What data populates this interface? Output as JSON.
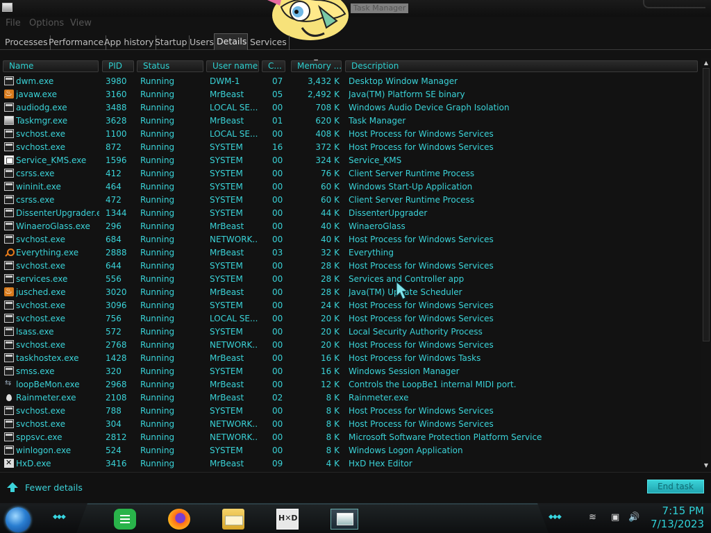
{
  "window": {
    "title": "Task Manager"
  },
  "menu": [
    "File",
    "Options",
    "View"
  ],
  "tabs": [
    {
      "label": "Processes",
      "active": false
    },
    {
      "label": "Performance",
      "active": false
    },
    {
      "label": "App history",
      "active": false
    },
    {
      "label": "Startup",
      "active": false
    },
    {
      "label": "Users",
      "active": false
    },
    {
      "label": "Details",
      "active": true
    },
    {
      "label": "Services",
      "active": false
    }
  ],
  "columns": [
    "Name",
    "PID",
    "Status",
    "User name",
    "C...",
    "Memory ...",
    "Description"
  ],
  "rows": [
    {
      "icon": "exe-icon",
      "name": "dwm.exe",
      "pid": "3980",
      "status": "Running",
      "user": "DWM-1",
      "cpu": "07",
      "mem": "3,432 K",
      "desc": "Desktop Window Manager"
    },
    {
      "icon": "java-icon",
      "name": "javaw.exe",
      "pid": "3160",
      "status": "Running",
      "user": "MrBeast",
      "cpu": "05",
      "mem": "2,492 K",
      "desc": "Java(TM) Platform SE binary"
    },
    {
      "icon": "exe-icon",
      "name": "audiodg.exe",
      "pid": "3488",
      "status": "Running",
      "user": "LOCAL SE...",
      "cpu": "00",
      "mem": "708 K",
      "desc": "Windows Audio Device Graph Isolation"
    },
    {
      "icon": "task-manager-icon",
      "name": "Taskmgr.exe",
      "pid": "3628",
      "status": "Running",
      "user": "MrBeast",
      "cpu": "01",
      "mem": "620 K",
      "desc": "Task Manager"
    },
    {
      "icon": "exe-icon",
      "name": "svchost.exe",
      "pid": "1100",
      "status": "Running",
      "user": "LOCAL SE...",
      "cpu": "00",
      "mem": "408 K",
      "desc": "Host Process for Windows Services"
    },
    {
      "icon": "exe-icon",
      "name": "svchost.exe",
      "pid": "872",
      "status": "Running",
      "user": "SYSTEM",
      "cpu": "16",
      "mem": "372 K",
      "desc": "Host Process for Windows Services"
    },
    {
      "icon": "service-icon",
      "name": "Service_KMS.exe",
      "pid": "1596",
      "status": "Running",
      "user": "SYSTEM",
      "cpu": "00",
      "mem": "324 K",
      "desc": "Service_KMS"
    },
    {
      "icon": "exe-icon",
      "name": "csrss.exe",
      "pid": "412",
      "status": "Running",
      "user": "SYSTEM",
      "cpu": "00",
      "mem": "76 K",
      "desc": "Client Server Runtime Process"
    },
    {
      "icon": "exe-icon",
      "name": "wininit.exe",
      "pid": "464",
      "status": "Running",
      "user": "SYSTEM",
      "cpu": "00",
      "mem": "60 K",
      "desc": "Windows Start-Up Application"
    },
    {
      "icon": "exe-icon",
      "name": "csrss.exe",
      "pid": "472",
      "status": "Running",
      "user": "SYSTEM",
      "cpu": "00",
      "mem": "60 K",
      "desc": "Client Server Runtime Process"
    },
    {
      "icon": "exe-icon",
      "name": "DissenterUpgrader.exe",
      "pid": "1344",
      "status": "Running",
      "user": "SYSTEM",
      "cpu": "00",
      "mem": "44 K",
      "desc": "DissenterUpgrader"
    },
    {
      "icon": "exe-icon",
      "name": "WinaeroGlass.exe",
      "pid": "296",
      "status": "Running",
      "user": "MrBeast",
      "cpu": "00",
      "mem": "40 K",
      "desc": "WinaeroGlass"
    },
    {
      "icon": "exe-icon",
      "name": "svchost.exe",
      "pid": "684",
      "status": "Running",
      "user": "NETWORK...",
      "cpu": "00",
      "mem": "40 K",
      "desc": "Host Process for Windows Services"
    },
    {
      "icon": "search-icon",
      "name": "Everything.exe",
      "pid": "2888",
      "status": "Running",
      "user": "MrBeast",
      "cpu": "03",
      "mem": "32 K",
      "desc": "Everything"
    },
    {
      "icon": "exe-icon",
      "name": "svchost.exe",
      "pid": "644",
      "status": "Running",
      "user": "SYSTEM",
      "cpu": "00",
      "mem": "28 K",
      "desc": "Host Process for Windows Services"
    },
    {
      "icon": "exe-icon",
      "name": "services.exe",
      "pid": "556",
      "status": "Running",
      "user": "SYSTEM",
      "cpu": "00",
      "mem": "28 K",
      "desc": "Services and Controller app"
    },
    {
      "icon": "java-icon",
      "name": "jusched.exe",
      "pid": "3020",
      "status": "Running",
      "user": "MrBeast",
      "cpu": "00",
      "mem": "28 K",
      "desc": "Java(TM) Update Scheduler"
    },
    {
      "icon": "exe-icon",
      "name": "svchost.exe",
      "pid": "3096",
      "status": "Running",
      "user": "SYSTEM",
      "cpu": "00",
      "mem": "24 K",
      "desc": "Host Process for Windows Services"
    },
    {
      "icon": "exe-icon",
      "name": "svchost.exe",
      "pid": "756",
      "status": "Running",
      "user": "LOCAL SE...",
      "cpu": "00",
      "mem": "20 K",
      "desc": "Host Process for Windows Services"
    },
    {
      "icon": "exe-icon",
      "name": "lsass.exe",
      "pid": "572",
      "status": "Running",
      "user": "SYSTEM",
      "cpu": "00",
      "mem": "20 K",
      "desc": "Local Security Authority Process"
    },
    {
      "icon": "exe-icon",
      "name": "svchost.exe",
      "pid": "2768",
      "status": "Running",
      "user": "NETWORK...",
      "cpu": "00",
      "mem": "20 K",
      "desc": "Host Process for Windows Services"
    },
    {
      "icon": "exe-icon",
      "name": "taskhostex.exe",
      "pid": "1428",
      "status": "Running",
      "user": "MrBeast",
      "cpu": "00",
      "mem": "16 K",
      "desc": "Host Process for Windows Tasks"
    },
    {
      "icon": "exe-icon",
      "name": "smss.exe",
      "pid": "320",
      "status": "Running",
      "user": "SYSTEM",
      "cpu": "00",
      "mem": "16 K",
      "desc": "Windows Session Manager"
    },
    {
      "icon": "midi-loop-icon",
      "name": "loopBeMon.exe",
      "pid": "2968",
      "status": "Running",
      "user": "MrBeast",
      "cpu": "00",
      "mem": "12 K",
      "desc": "Controls the LoopBe1 internal MIDI port."
    },
    {
      "icon": "drop-icon",
      "name": "Rainmeter.exe",
      "pid": "2108",
      "status": "Running",
      "user": "MrBeast",
      "cpu": "02",
      "mem": "8 K",
      "desc": "Rainmeter.exe"
    },
    {
      "icon": "exe-icon",
      "name": "svchost.exe",
      "pid": "788",
      "status": "Running",
      "user": "SYSTEM",
      "cpu": "00",
      "mem": "8 K",
      "desc": "Host Process for Windows Services"
    },
    {
      "icon": "exe-icon",
      "name": "svchost.exe",
      "pid": "304",
      "status": "Running",
      "user": "NETWORK...",
      "cpu": "00",
      "mem": "8 K",
      "desc": "Host Process for Windows Services"
    },
    {
      "icon": "exe-icon",
      "name": "sppsvc.exe",
      "pid": "2812",
      "status": "Running",
      "user": "NETWORK...",
      "cpu": "00",
      "mem": "8 K",
      "desc": "Microsoft Software Protection Platform Service"
    },
    {
      "icon": "exe-icon",
      "name": "winlogon.exe",
      "pid": "524",
      "status": "Running",
      "user": "SYSTEM",
      "cpu": "00",
      "mem": "8 K",
      "desc": "Windows Logon Application"
    },
    {
      "icon": "hxd-icon",
      "name": "HxD.exe",
      "pid": "3416",
      "status": "Running",
      "user": "MrBeast",
      "cpu": "09",
      "mem": "4 K",
      "desc": "HxD Hex Editor"
    }
  ],
  "footer": {
    "fewer_details": "Fewer details",
    "end_task": "End task"
  },
  "taskbar": {
    "apps": [
      "green-notes-icon",
      "firefox-icon",
      "file-explorer-icon",
      "hxd-icon",
      "task-manager-icon"
    ],
    "time": "7:15 PM",
    "date": "7/13/2023"
  },
  "colors": {
    "accent": "#3ad3d8",
    "background": "#121212"
  }
}
